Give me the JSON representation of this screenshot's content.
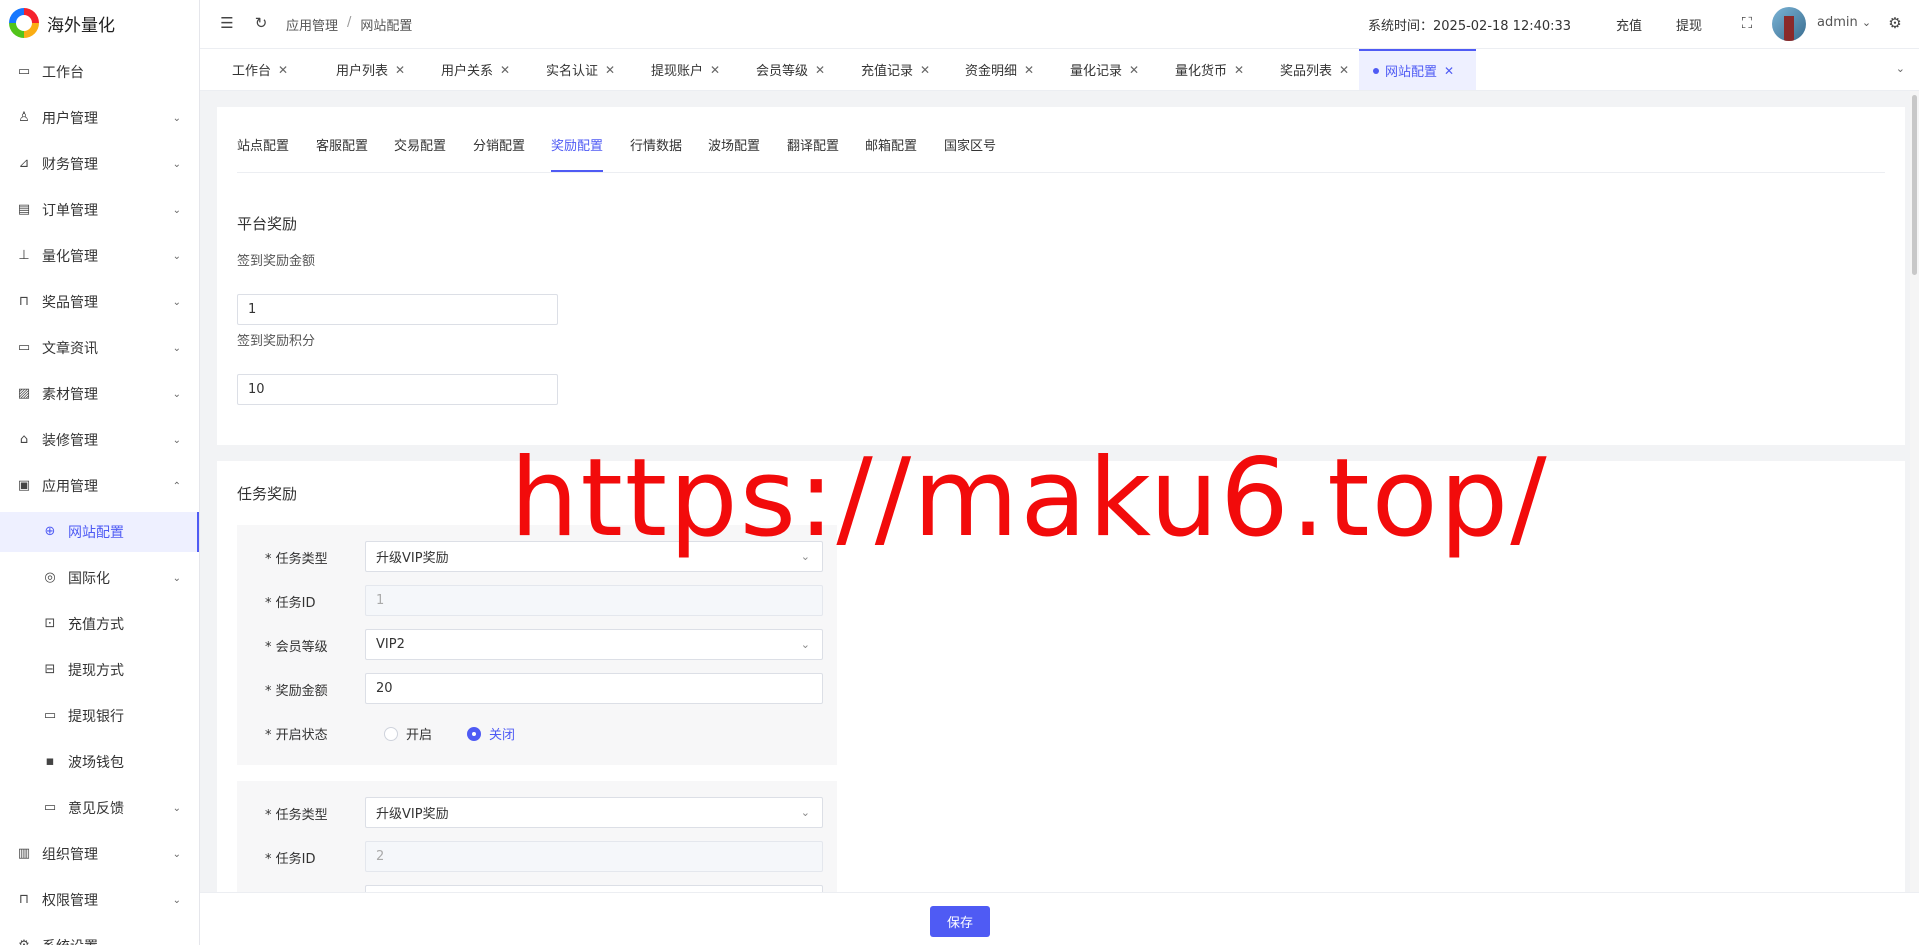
{
  "app": {
    "title": "海外量化"
  },
  "sidebar": {
    "items": [
      {
        "label": "工作台",
        "icon": "monitor-icon",
        "glyph": "▭",
        "chevron": ""
      },
      {
        "label": "用户管理",
        "icon": "user-icon",
        "glyph": "♙",
        "chevron": "⌄"
      },
      {
        "label": "财务管理",
        "icon": "chart-icon",
        "glyph": "⊿",
        "chevron": "⌄"
      },
      {
        "label": "订单管理",
        "icon": "document-icon",
        "glyph": "▤",
        "chevron": "⌄"
      },
      {
        "label": "量化管理",
        "icon": "tool-icon",
        "glyph": "⊥",
        "chevron": "⌄"
      },
      {
        "label": "奖品管理",
        "icon": "bag-icon",
        "glyph": "⊓",
        "chevron": "⌄"
      },
      {
        "label": "文章资讯",
        "icon": "message-icon",
        "glyph": "▭",
        "chevron": "⌄"
      },
      {
        "label": "素材管理",
        "icon": "image-icon",
        "glyph": "▨",
        "chevron": "⌄"
      },
      {
        "label": "装修管理",
        "icon": "shop-icon",
        "glyph": "⌂",
        "chevron": "⌄"
      },
      {
        "label": "应用管理",
        "icon": "app-icon",
        "glyph": "▣",
        "chevron": "⌃"
      },
      {
        "label": "网站配置",
        "icon": "globe-icon",
        "glyph": "⊕",
        "chevron": "",
        "sub": true,
        "active": true
      },
      {
        "label": "国际化",
        "icon": "language-icon",
        "glyph": "◎",
        "chevron": "⌄",
        "sub": true
      },
      {
        "label": "充值方式",
        "icon": "recharge-icon",
        "glyph": "⊡",
        "chevron": "",
        "sub": true
      },
      {
        "label": "提现方式",
        "icon": "withdraw-icon",
        "glyph": "⊟",
        "chevron": "",
        "sub": true
      },
      {
        "label": "提现银行",
        "icon": "card-icon",
        "glyph": "▭",
        "chevron": "",
        "sub": true
      },
      {
        "label": "波场钱包",
        "icon": "wallet-icon",
        "glyph": "▪",
        "chevron": "",
        "sub": true
      },
      {
        "label": "意见反馈",
        "icon": "feedback-icon",
        "glyph": "▭",
        "chevron": "⌄",
        "sub": true
      },
      {
        "label": "组织管理",
        "icon": "building-icon",
        "glyph": "▥",
        "chevron": "⌄"
      },
      {
        "label": "权限管理",
        "icon": "lock-icon",
        "glyph": "⊓",
        "chevron": "⌄"
      },
      {
        "label": "系统设置",
        "icon": "settings-icon",
        "glyph": "⚙",
        "chevron": "⌄"
      }
    ]
  },
  "header": {
    "breadcrumb": [
      "应用管理",
      "网站配置"
    ],
    "breadcrumb_sep": "/",
    "system_time": "系统时间：2025-02-18 12:40:33",
    "recharge": "充值",
    "withdraw": "提现",
    "user": "admin",
    "user_chevron": "⌄"
  },
  "tabs": [
    {
      "label": "工作台",
      "active": false
    },
    {
      "label": "用户列表",
      "active": false
    },
    {
      "label": "用户关系",
      "active": false
    },
    {
      "label": "实名认证",
      "active": false
    },
    {
      "label": "提现账户",
      "active": false
    },
    {
      "label": "会员等级",
      "active": false
    },
    {
      "label": "充值记录",
      "active": false
    },
    {
      "label": "资金明细",
      "active": false
    },
    {
      "label": "量化记录",
      "active": false
    },
    {
      "label": "量化货币",
      "active": false
    },
    {
      "label": "奖品列表",
      "active": false
    },
    {
      "label": "网站配置",
      "active": true
    }
  ],
  "subtabs": [
    "站点配置",
    "客服配置",
    "交易配置",
    "分销配置",
    "奖励配置",
    "行情数据",
    "波场配置",
    "翻译配置",
    "邮箱配置",
    "国家区号"
  ],
  "subtabs_active": "奖励配置",
  "platform_reward": {
    "title": "平台奖励",
    "signin_amount_label": "签到奖励金额",
    "signin_amount_value": "1",
    "signin_points_label": "签到奖励积分",
    "signin_points_value": "10"
  },
  "task_reward": {
    "title": "任务奖励",
    "labels": {
      "type": "* 任务类型",
      "id": "* 任务ID",
      "level": "* 会员等级",
      "amount": "* 奖励金额",
      "status": "* 开启状态"
    },
    "status_on": "开启",
    "status_off": "关闭",
    "tasks": [
      {
        "type": "升级VIP奖励",
        "id": "1",
        "level": "VIP2",
        "amount": "20",
        "status": "关闭"
      },
      {
        "type": "升级VIP奖励",
        "id": "2"
      }
    ]
  },
  "footer": {
    "save": "保存"
  },
  "watermark": "https://maku6.top/",
  "colors": {
    "accent": "#4f5bf4",
    "watermark": "#f20b0b"
  }
}
